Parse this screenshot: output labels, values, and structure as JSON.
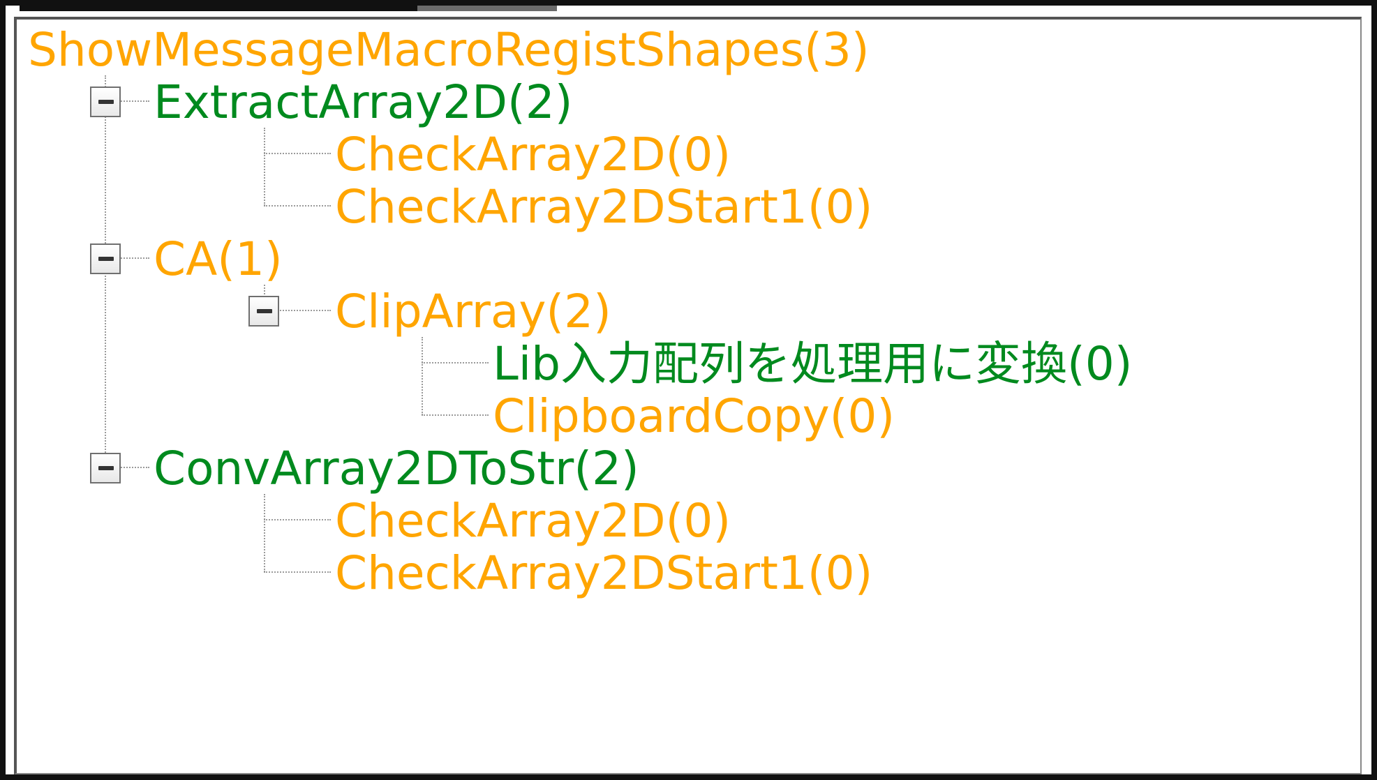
{
  "tree": {
    "root": {
      "label": "ShowMessageMacroRegistShapes(3)",
      "color": "#ffa500"
    },
    "nodes": [
      {
        "label": "ExtractArray2D(2)",
        "color": "#008a1e",
        "expanded": true,
        "children": [
          {
            "label": "CheckArray2D(0)",
            "color": "#ffa500"
          },
          {
            "label": "CheckArray2DStart1(0)",
            "color": "#ffa500"
          }
        ]
      },
      {
        "label": "CA(1)",
        "color": "#ffa500",
        "expanded": true,
        "children": [
          {
            "label": "ClipArray(2)",
            "color": "#ffa500",
            "expanded": true,
            "children": [
              {
                "label": "Lib入力配列を処理用に変換(0)",
                "color": "#008a1e"
              },
              {
                "label": "ClipboardCopy(0)",
                "color": "#ffa500"
              }
            ]
          }
        ]
      },
      {
        "label": "ConvArray2DToStr(2)",
        "color": "#008a1e",
        "expanded": true,
        "children": [
          {
            "label": "CheckArray2D(0)",
            "color": "#ffa500"
          },
          {
            "label": "CheckArray2DStart1(0)",
            "color": "#ffa500"
          }
        ]
      }
    ],
    "expander_icon": "minus-box-icon",
    "colors": {
      "orange": "#ffa500",
      "green": "#008a1e",
      "connector": "#9a9a9a"
    }
  }
}
